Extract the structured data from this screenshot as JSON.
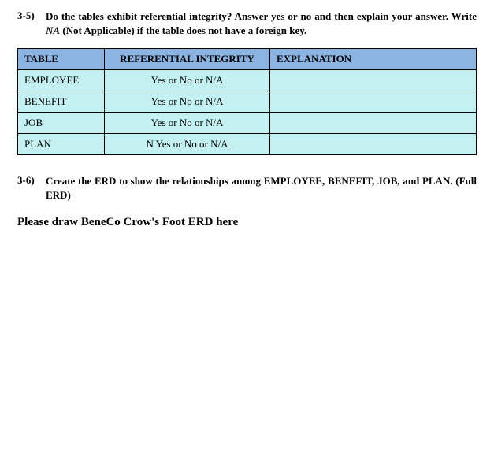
{
  "q35": {
    "num": "3-5)",
    "text_pre": "Do the tables exhibit referential integrity? Answer yes or no and then explain your answer. Write ",
    "na": "NA",
    "text_post": " (Not Applicable) if the table does not have a foreign key."
  },
  "table": {
    "header": {
      "c1": "TABLE",
      "c2": "REFERENTIAL INTEGRITY",
      "c3": "EXPLANATION"
    },
    "rows": [
      {
        "c1": "EMPLOYEE",
        "c2": "Yes or No or N/A",
        "c3": ""
      },
      {
        "c1": "BENEFIT",
        "c2": "Yes or No or N/A",
        "c3": ""
      },
      {
        "c1": "JOB",
        "c2": "Yes or No or N/A",
        "c3": ""
      },
      {
        "c1": "PLAN",
        "c2": "N Yes or No or N/A",
        "c3": ""
      }
    ]
  },
  "q36": {
    "num": "3-6)",
    "text": "Create the ERD to show the relationships among EMPLOYEE, BENEFIT, JOB, and PLAN. (Full ERD)"
  },
  "erd_prompt": "Please draw BeneCo Crow's Foot ERD  here"
}
